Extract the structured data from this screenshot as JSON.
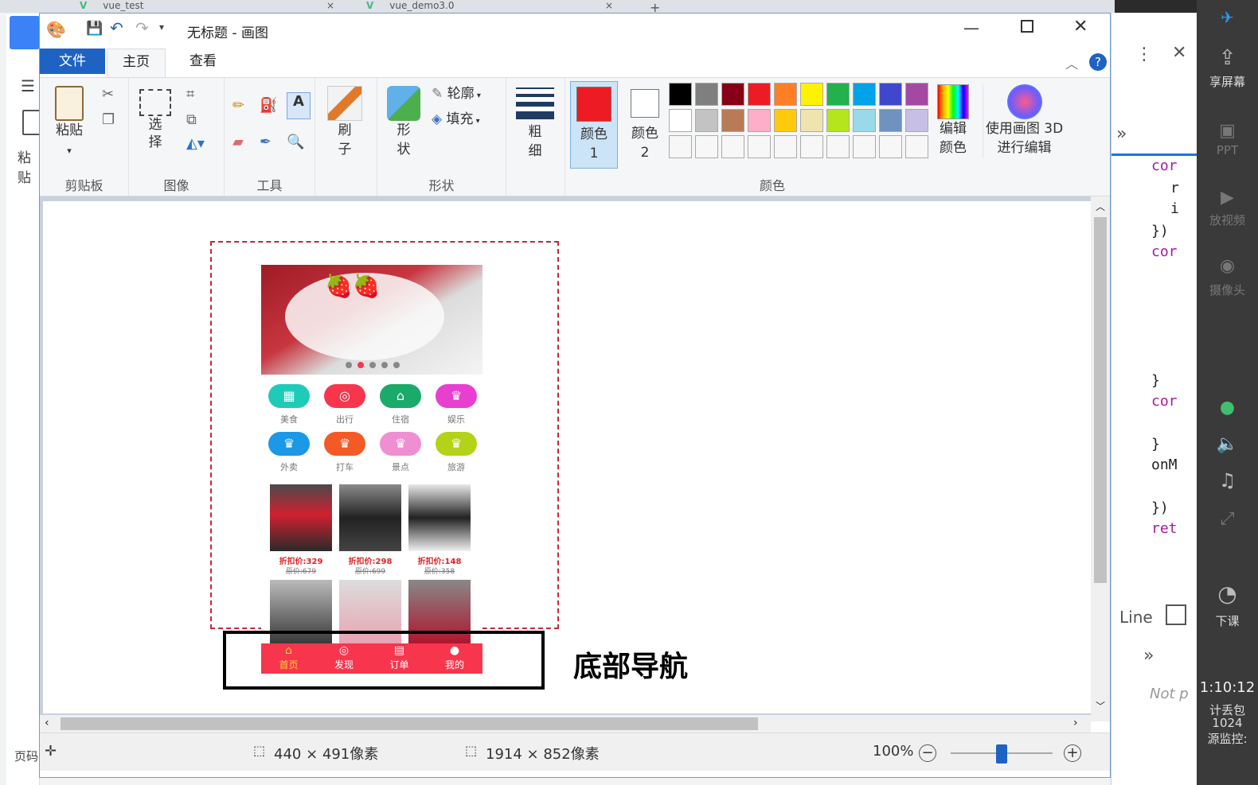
{
  "browser": {
    "tabs": [
      {
        "label": "vue_test"
      },
      {
        "label": "vue_demo3.0"
      }
    ],
    "left_paste_label": "粘贴",
    "left_page_label": "页码"
  },
  "paint": {
    "title": "无标题 - 画图",
    "tabs": {
      "file": "文件",
      "home": "主页",
      "view": "查看"
    },
    "groups": {
      "clipboard": {
        "label": "剪贴板",
        "paste": "粘贴"
      },
      "image": {
        "label": "图像",
        "select": "选择"
      },
      "tools": {
        "label": "工具"
      },
      "brush": {
        "label": "刷子"
      },
      "shapes": {
        "label": "形状",
        "shape": "形状",
        "outline": "轮廓",
        "fill": "填充"
      },
      "size": {
        "label": "粗细"
      },
      "colors": {
        "label": "颜色",
        "color1": "颜色 1",
        "color2": "颜色 2",
        "edit": "编辑颜色",
        "paint3d": "使用画图 3D 进行编辑"
      }
    },
    "palette": {
      "row1": [
        "#000000",
        "#7f7f7f",
        "#880015",
        "#ed1c24",
        "#ff7f27",
        "#fff200",
        "#22b14c",
        "#00a2e8",
        "#3f48cc",
        "#a349a4"
      ],
      "row2": [
        "#ffffff",
        "#c3c3c3",
        "#b97a57",
        "#ffaec9",
        "#ffc90e",
        "#efe4b0",
        "#b5e61d",
        "#99d9ea",
        "#7092be",
        "#c8bfe7"
      ],
      "color1": "#ed1c24",
      "color2": "#ffffff"
    },
    "status": {
      "selection": "440 × 491像素",
      "image_size": "1914 × 852像素",
      "zoom": "100%"
    },
    "zoom_fraction": 0.5
  },
  "canvas": {
    "annotation": "底部导航",
    "phone": {
      "icons": [
        {
          "label": "美食",
          "color": "#1ecbb8",
          "glyph": "▦"
        },
        {
          "label": "出行",
          "color": "#f7364e",
          "glyph": "◎"
        },
        {
          "label": "住宿",
          "color": "#1aaa6a",
          "glyph": "⌂"
        },
        {
          "label": "娱乐",
          "color": "#e93fd1",
          "glyph": "♛"
        },
        {
          "label": "外卖",
          "color": "#1b98e6",
          "glyph": "♛"
        },
        {
          "label": "打车",
          "color": "#f45a25",
          "glyph": "♛"
        },
        {
          "label": "景点",
          "color": "#ef8fd2",
          "glyph": "♛"
        },
        {
          "label": "旅游",
          "color": "#b4d217",
          "glyph": "♛"
        }
      ],
      "products": [
        {
          "price": "折扣价:329",
          "orig": "原价:679"
        },
        {
          "price": "折扣价:298",
          "orig": "原价:699"
        },
        {
          "price": "折扣价:148",
          "orig": "原价:358"
        }
      ],
      "nav": [
        "首页",
        "发现",
        "订单",
        "我的"
      ]
    }
  },
  "devtools": {
    "code_lines": [
      "cor",
      "r",
      "i",
      "})",
      "cor",
      "}",
      "cor",
      "}",
      "onM",
      "})",
      "ret"
    ],
    "line_label": "Line",
    "not_paused": "Not p"
  },
  "sidepanel": {
    "share_screen": "享屏幕",
    "ppt": "PPT",
    "video": "放视频",
    "camera": "摄像头",
    "leave_class": "下课",
    "clock": "1:10:12",
    "packet_loss": "计丢包",
    "value": "1024",
    "monitor": "源监控:"
  }
}
